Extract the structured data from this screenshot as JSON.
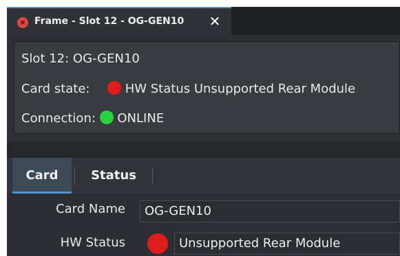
{
  "window": {
    "tab_title": "Frame - Slot 12 - OG-GEN10",
    "close_glyph": "×",
    "tab_close_glyph": "✕"
  },
  "info": {
    "slot": "Slot 12: OG-GEN10",
    "card_state_label": "Card state:",
    "card_state_value": "HW Status Unsupported Rear Module",
    "card_state_color": "#e01b1b",
    "connection_label": "Connection:",
    "connection_value": "ONLINE",
    "connection_color": "#27d33e"
  },
  "tabs": [
    {
      "label": "Card",
      "active": true
    },
    {
      "label": "Status",
      "active": false
    }
  ],
  "card": {
    "card_name_label": "Card Name",
    "card_name_value": "OG-GEN10",
    "hw_status_label": "HW Status",
    "hw_status_value": "Unsupported Rear Module",
    "hw_status_color": "#e01b1b"
  },
  "colors": {
    "accent": "#4f93d1"
  }
}
